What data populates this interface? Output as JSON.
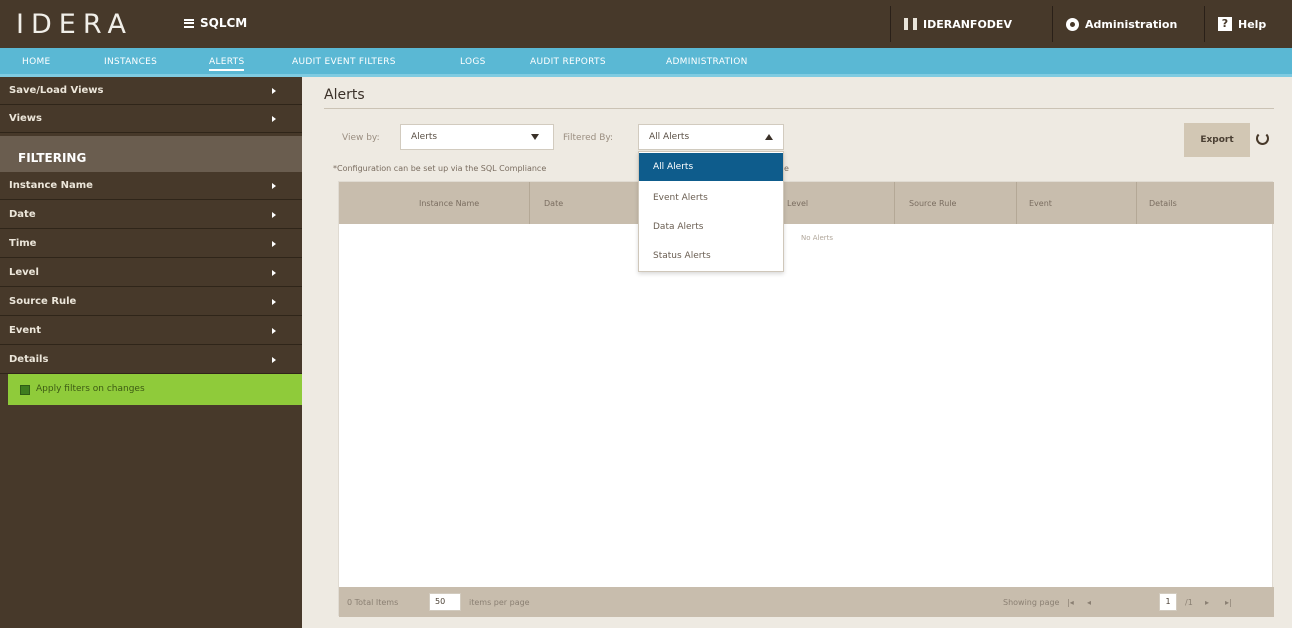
{
  "header": {
    "logo": "IDERA",
    "product": "SQLCM",
    "user": "IDERANFODEV",
    "admin_label": "Administration",
    "help_label": "Help"
  },
  "nav": {
    "items": [
      "HOME",
      "INSTANCES",
      "ALERTS",
      "AUDIT EVENT FILTERS",
      "LOGS",
      "AUDIT REPORTS",
      "ADMINISTRATION"
    ],
    "active": "ALERTS"
  },
  "sidebar": {
    "top_items": [
      "Save/Load Views",
      "Views"
    ],
    "filtering_heading": "FILTERING",
    "filters": [
      "Instance Name",
      "Date",
      "Time",
      "Level",
      "Source Rule",
      "Event",
      "Details"
    ],
    "apply_label": "Apply filters on changes"
  },
  "main": {
    "title": "Alerts",
    "view_by_label": "View by:",
    "view_by_value": "Alerts",
    "filtered_by_label": "Filtered By:",
    "filtered_by_value": "All Alerts",
    "note": "*Configuration can be set up via the SQL Compliance",
    "note_tail": "e",
    "export_label": "Export",
    "columns": [
      "Instance Name",
      "Date",
      "Level",
      "Source Rule",
      "Event",
      "Details"
    ],
    "no_data": "No Alerts",
    "footer": {
      "total_items": "0 Total Items",
      "per_page_value": "50",
      "per_page_label": "items per page",
      "showing_page": "Showing page",
      "page_value": "1"
    }
  },
  "dropdown": {
    "options": [
      "All Alerts",
      "Event Alerts",
      "Data Alerts",
      "Status Alerts"
    ],
    "selected": "All Alerts"
  },
  "colors": {
    "header_bg": "#47392a",
    "nav_bg": "#5ab8d4",
    "apply_green": "#8fcb3a",
    "selected_blue": "#0e5c8c"
  }
}
